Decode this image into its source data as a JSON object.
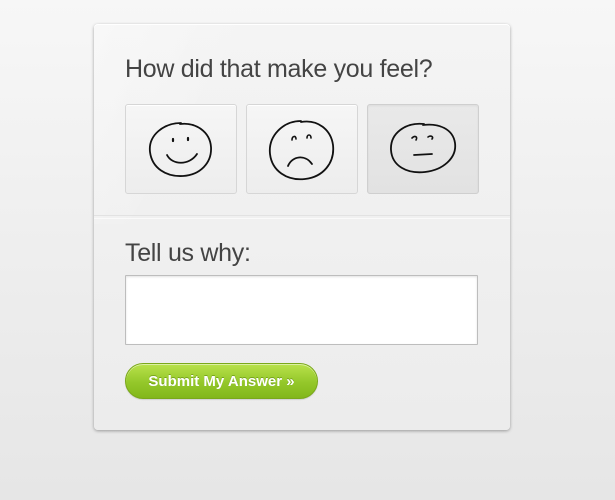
{
  "question": "How did that make you feel?",
  "faces": [
    {
      "icon": "happy-face-icon",
      "selected": false
    },
    {
      "icon": "sad-face-icon",
      "selected": false
    },
    {
      "icon": "neutral-face-icon",
      "selected": true
    }
  ],
  "why_label": "Tell us why:",
  "why_input": {
    "value": "",
    "placeholder": ""
  },
  "submit_label": "Submit My Answer »",
  "colors": {
    "accent": "#94c72a",
    "text": "#444444",
    "card": "#f0f0f0"
  }
}
